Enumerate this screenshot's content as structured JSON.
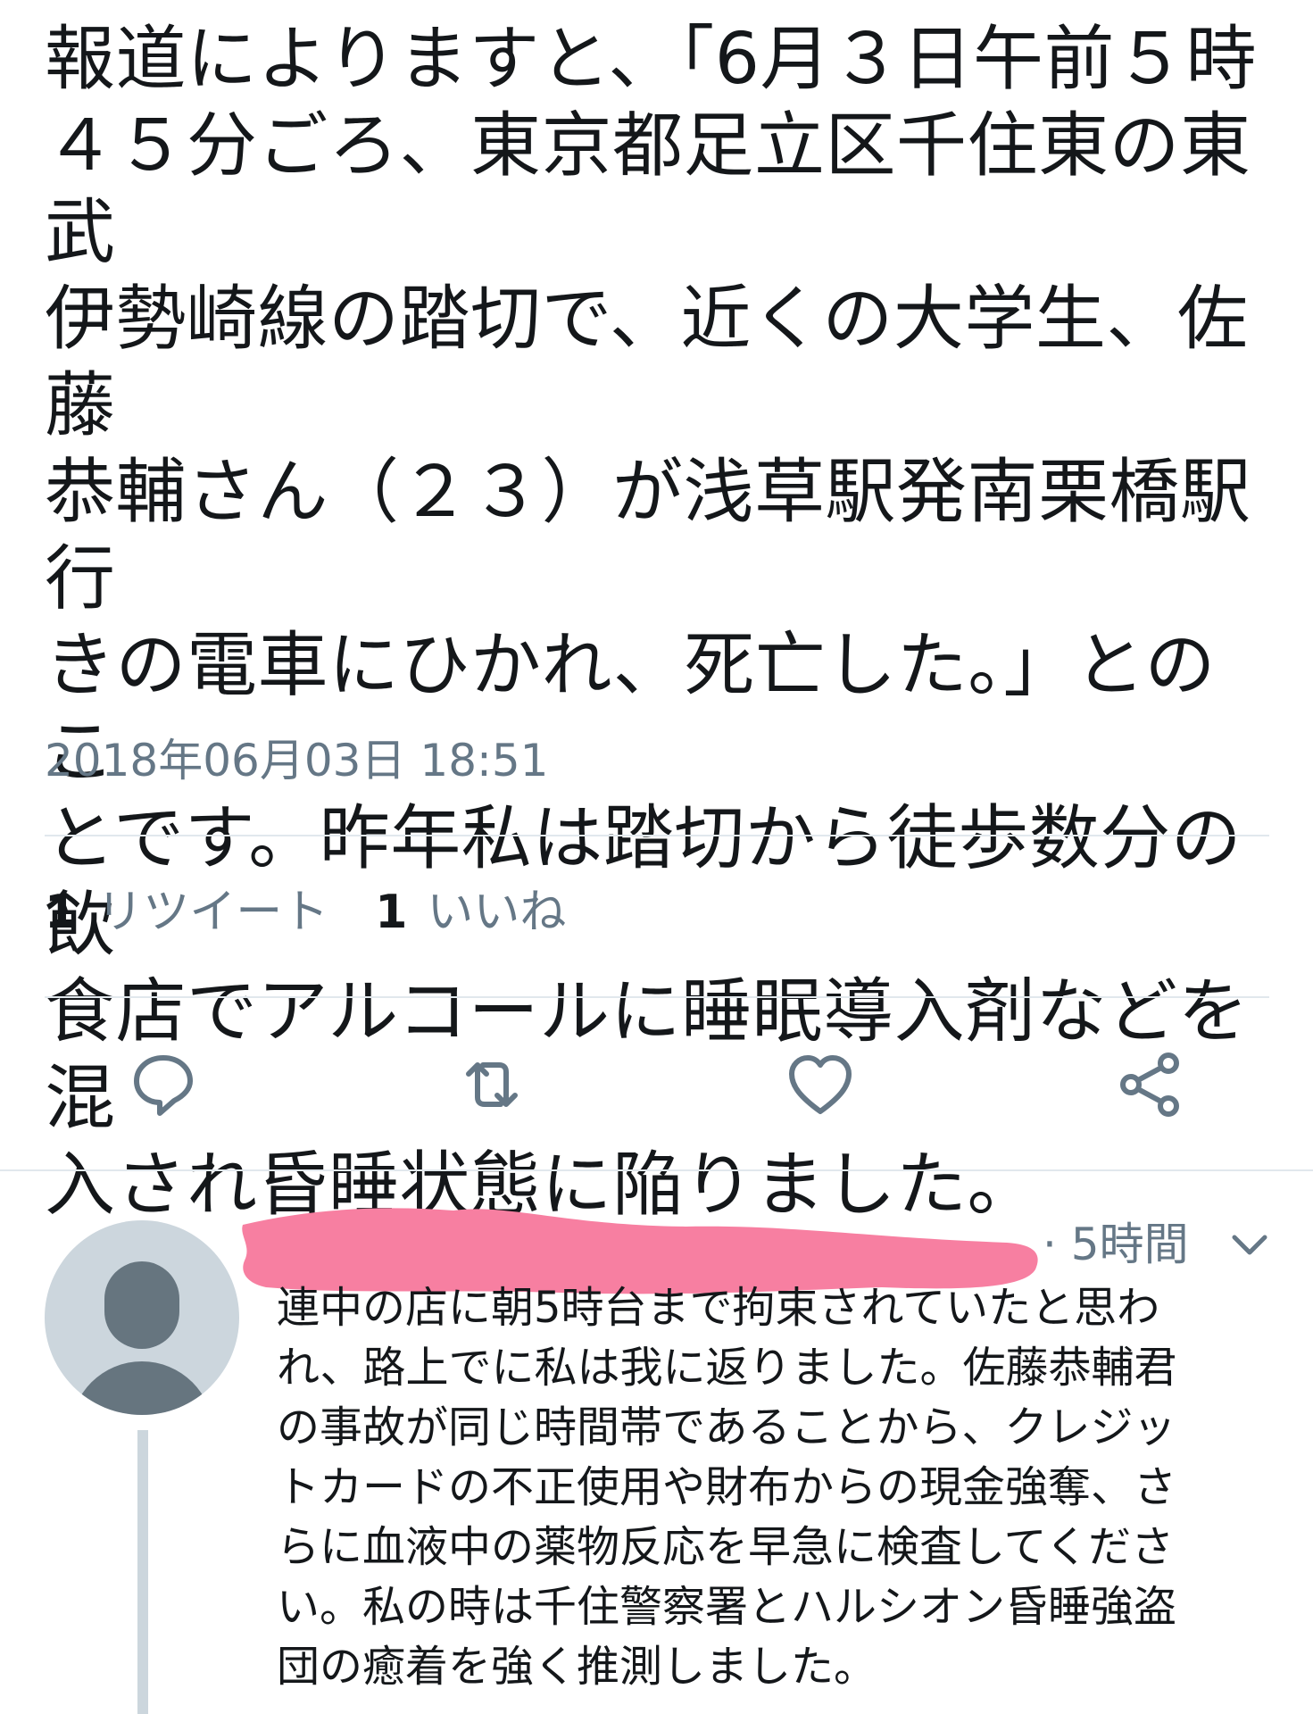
{
  "tweet": {
    "text": "報道によりますと、「6月３日午前５時\n４５分ごろ、東京都足立区千住東の東武\n伊勢崎線の踏切で、近くの大学生、佐藤\n恭輔さん（２３）が浅草駅発南栗橋駅行\nきの電車にひかれ、死亡した。」とのこ\nとです。昨年私は踏切から徒歩数分の飲\n食店でアルコールに睡眠導入剤などを混\n入され昏睡状態に陥りました。",
    "timestamp": "2018年06月03日 18:51",
    "retweet_count": "1",
    "retweet_label": "リツイート",
    "like_count": "1",
    "like_label": "いいね"
  },
  "actions": [
    {
      "name": "reply",
      "icon": "reply-icon"
    },
    {
      "name": "retweet",
      "icon": "retweet-icon"
    },
    {
      "name": "like",
      "icon": "heart-icon"
    },
    {
      "name": "share",
      "icon": "share-icon"
    }
  ],
  "reply": {
    "time": "· 5時間",
    "text": "連中の店に朝5時台まで拘束されていたと思わ\nれ、路上でに私は我に返りました。佐藤恭輔君\nの事故が同じ時間帯であることから、クレジッ\nトカードの不正使用や財布からの現金強奪、さ\nらに血液中の薬物反応を早急に検査してくださ\nい。私の時は千住警察署とハルシオン昏睡強盗\n団の癒着を強く推測しました。"
  },
  "colors": {
    "text_primary": "#14171a",
    "text_secondary": "#657786",
    "divider": "#e1e8ed",
    "icon": "#657786",
    "avatar_bg": "#ccd6dd",
    "avatar_fg": "#66757f",
    "redaction": "#f77fa1"
  }
}
